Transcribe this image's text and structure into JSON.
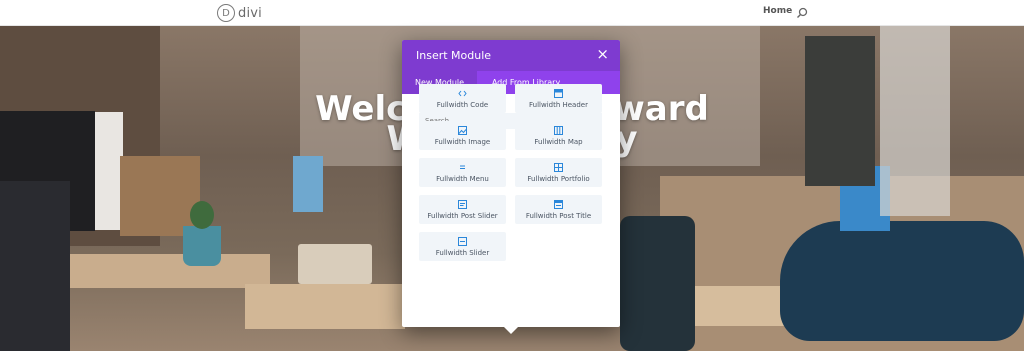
{
  "header": {
    "logo_letter": "D",
    "logo_text": "divi",
    "nav_home": "Home",
    "search_icon": "search-icon"
  },
  "hero": {
    "title_line1": "Welcome to Forward",
    "title_line2": "Work Agency"
  },
  "modal": {
    "title": "Insert Module",
    "close_label": "×",
    "tabs": [
      {
        "label": "New Module",
        "active": true
      },
      {
        "label": "Add From Library",
        "active": false
      }
    ],
    "search_placeholder": "Search...",
    "modules": [
      {
        "label": "Fullwidth Code",
        "icon": "code-icon"
      },
      {
        "label": "Fullwidth Header",
        "icon": "header-icon"
      },
      {
        "label": "Fullwidth Image",
        "icon": "image-icon"
      },
      {
        "label": "Fullwidth Map",
        "icon": "map-icon"
      },
      {
        "label": "Fullwidth Menu",
        "icon": "menu-icon"
      },
      {
        "label": "Fullwidth Portfolio",
        "icon": "portfolio-icon"
      },
      {
        "label": "Fullwidth Post Slider",
        "icon": "post-slider-icon"
      },
      {
        "label": "Fullwidth Post Title",
        "icon": "post-title-icon"
      },
      {
        "label": "Fullwidth Slider",
        "icon": "slider-icon"
      }
    ]
  },
  "colors": {
    "modal_header": "#7e3bd0",
    "modal_tabs": "#8f42ec",
    "module_tile": "#f1f5f9",
    "icon_blue": "#2b87da"
  }
}
